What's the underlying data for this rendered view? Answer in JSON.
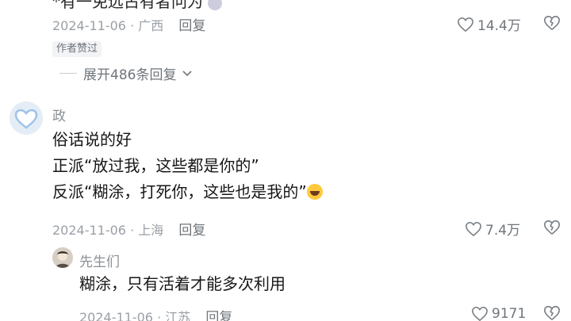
{
  "comment_prev": {
    "cut_text": "*有一免远占有者问为",
    "date": "2024-11-06",
    "location": "广西",
    "reply_label": "回复",
    "likes": "14.4万",
    "author_tag": "作者赞过",
    "expand_label": "展开486条回复"
  },
  "comment_main": {
    "username": "政",
    "lines": [
      "俗话说的好",
      "正派“放过我，这些都是你的”",
      "反派“糊涂，打死你，这些也是我的”"
    ],
    "date": "2024-11-06",
    "location": "上海",
    "reply_label": "回复",
    "likes": "7.4万"
  },
  "reply": {
    "username": "先生们",
    "text": "糊涂，只有活着才能多次利用",
    "date": "2024-11-06",
    "location": "江苏",
    "reply_label": "回复",
    "likes": "9171"
  },
  "meta_separator": " · "
}
